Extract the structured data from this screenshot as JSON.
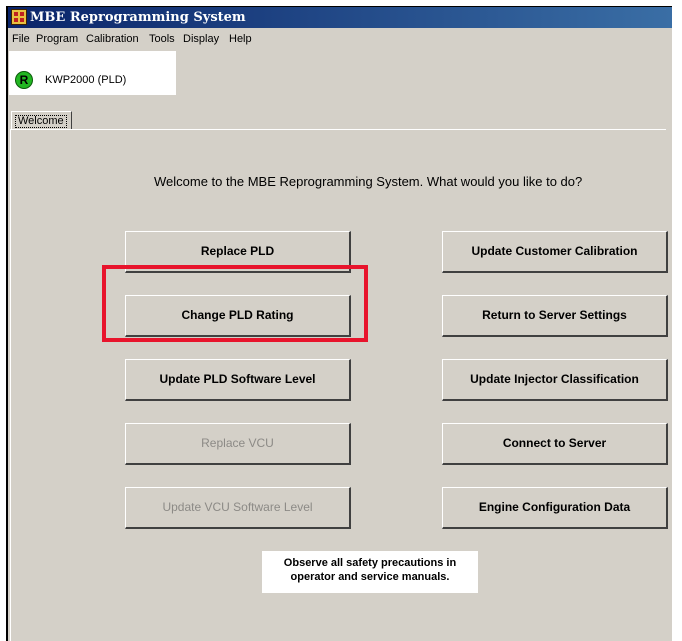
{
  "window": {
    "title": "MBE Reprogramming System",
    "app_icon": "mbe-app-icon"
  },
  "menubar": {
    "items": [
      "File",
      "Program",
      "Calibration",
      "Tools",
      "Display",
      "Help"
    ]
  },
  "connection": {
    "status_icon": "R",
    "status_color": "#22b622",
    "protocol": "KWP2000 (PLD)"
  },
  "tabs": [
    {
      "label": "Welcome",
      "selected": true
    }
  ],
  "main": {
    "welcome_text": "Welcome to the MBE Reprogramming System.  What would you like to do?",
    "left_buttons": [
      {
        "label": "Replace PLD",
        "enabled": true
      },
      {
        "label": "Change PLD Rating",
        "enabled": true,
        "highlighted": true
      },
      {
        "label": "Update PLD Software Level",
        "enabled": true
      },
      {
        "label": "Replace VCU",
        "enabled": false
      },
      {
        "label": "Update VCU Software Level",
        "enabled": false
      }
    ],
    "right_buttons": [
      {
        "label": "Update Customer Calibration",
        "enabled": true
      },
      {
        "label": "Return to Server Settings",
        "enabled": true
      },
      {
        "label": "Update Injector Classification",
        "enabled": true
      },
      {
        "label": "Connect to Server",
        "enabled": true
      },
      {
        "label": "Engine Configuration Data",
        "enabled": true
      }
    ],
    "notice": {
      "line1": "Observe all safety precautions in",
      "line2": "operator and service manuals."
    },
    "highlight_color": "#e8142c"
  }
}
